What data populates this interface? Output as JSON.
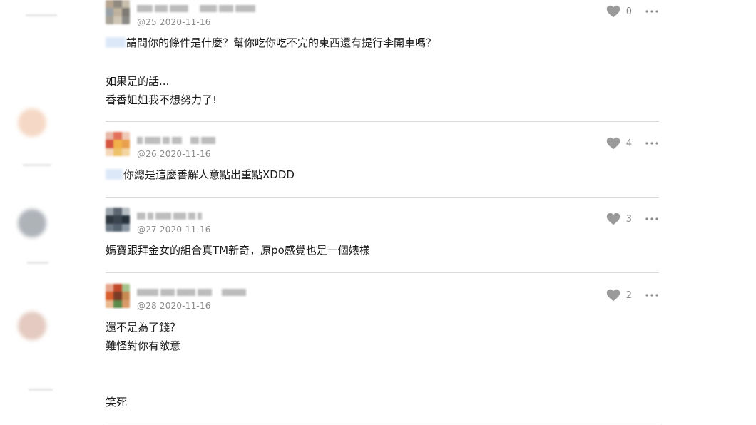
{
  "comments": [
    {
      "floor": "@25",
      "date": "2020-11-16",
      "likes": "0",
      "avatar_colors": [
        "#b7a58f",
        "#8f8a80",
        "#c9bfae",
        "#9aa1a6",
        "#c0b39d",
        "#7f7b74",
        "#a9a397",
        "#d0c6b6",
        "#8c8a86"
      ],
      "lines": [
        {
          "mention": true,
          "text": "請問你的條件是什麼？幫你吃你吃不完的東西還有提行李開車嗎？"
        },
        {
          "mention": false,
          "text": "如果是的話..."
        },
        {
          "mention": false,
          "text": "香香姐姐我不想努力了!"
        }
      ]
    },
    {
      "floor": "@26",
      "date": "2020-11-16",
      "likes": "4",
      "avatar_colors": [
        "#e7b8a7",
        "#e2705a",
        "#f0c9b6",
        "#d6553f",
        "#f2b24a",
        "#e9a04c",
        "#f4d7b9",
        "#eec26a",
        "#f3d5a2"
      ],
      "lines": [
        {
          "mention": true,
          "text": "你總是這麼善解人意點出重點XDDD"
        }
      ]
    },
    {
      "floor": "@27",
      "date": "2020-11-16",
      "likes": "3",
      "avatar_colors": [
        "#9aa3ab",
        "#5c6670",
        "#b7bec4",
        "#2f3840",
        "#3a4550",
        "#25303a",
        "#6d7a86",
        "#556270",
        "#8a96a2"
      ],
      "lines": [
        {
          "mention": false,
          "text": "媽寶跟拜金女的組合真TM新奇，原po感覺也是一個婊樣"
        }
      ]
    },
    {
      "floor": "@28",
      "date": "2020-11-16",
      "likes": "2",
      "avatar_colors": [
        "#e7a58c",
        "#c24a2a",
        "#a6c28c",
        "#d8602f",
        "#7a3b26",
        "#c98a52",
        "#e9b98f",
        "#5a8a4a",
        "#d99a6a"
      ],
      "lines": [
        {
          "mention": false,
          "text": "還不是為了錢？"
        },
        {
          "mention": false,
          "text": "難怪對你有敵意"
        },
        {
          "mention": false,
          "text": "笑死"
        }
      ]
    }
  ],
  "rail_avatar_colors": [
    "#f2c9ae",
    "#8d939b",
    "#d9b4a6"
  ]
}
